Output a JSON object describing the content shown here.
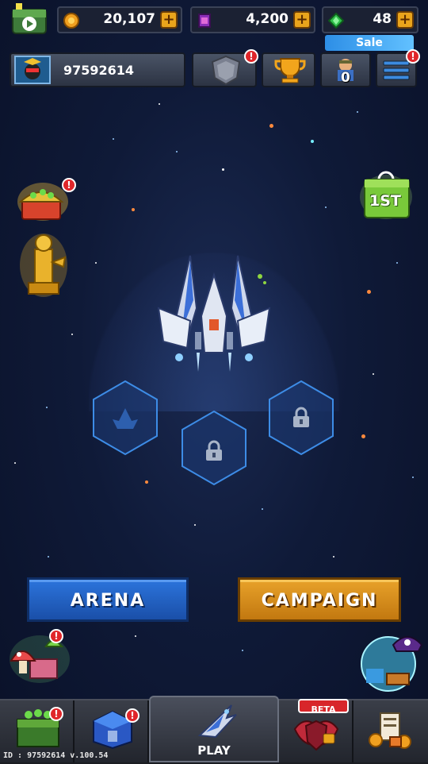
{
  "currencies": {
    "coins": "20,107",
    "cards": "4,200",
    "gems": "48"
  },
  "player": {
    "id": "97592614"
  },
  "sale_label": "Sale",
  "pass_count": "0",
  "alert_mark": "!",
  "plus_mark": "+",
  "modes": {
    "arena": "ARENA",
    "campaign": "CAMPAIGN"
  },
  "rank_badge": "1ST",
  "nav": {
    "play": "PLAY",
    "beta": "BETA"
  },
  "footer": "ID : 97592614 v.100.54",
  "colors": {
    "arena": "#1f5fc4",
    "campaign": "#d88d1c",
    "background": "#0f1a38",
    "alert": "#e0262a",
    "sale": "#2d8ee6"
  }
}
